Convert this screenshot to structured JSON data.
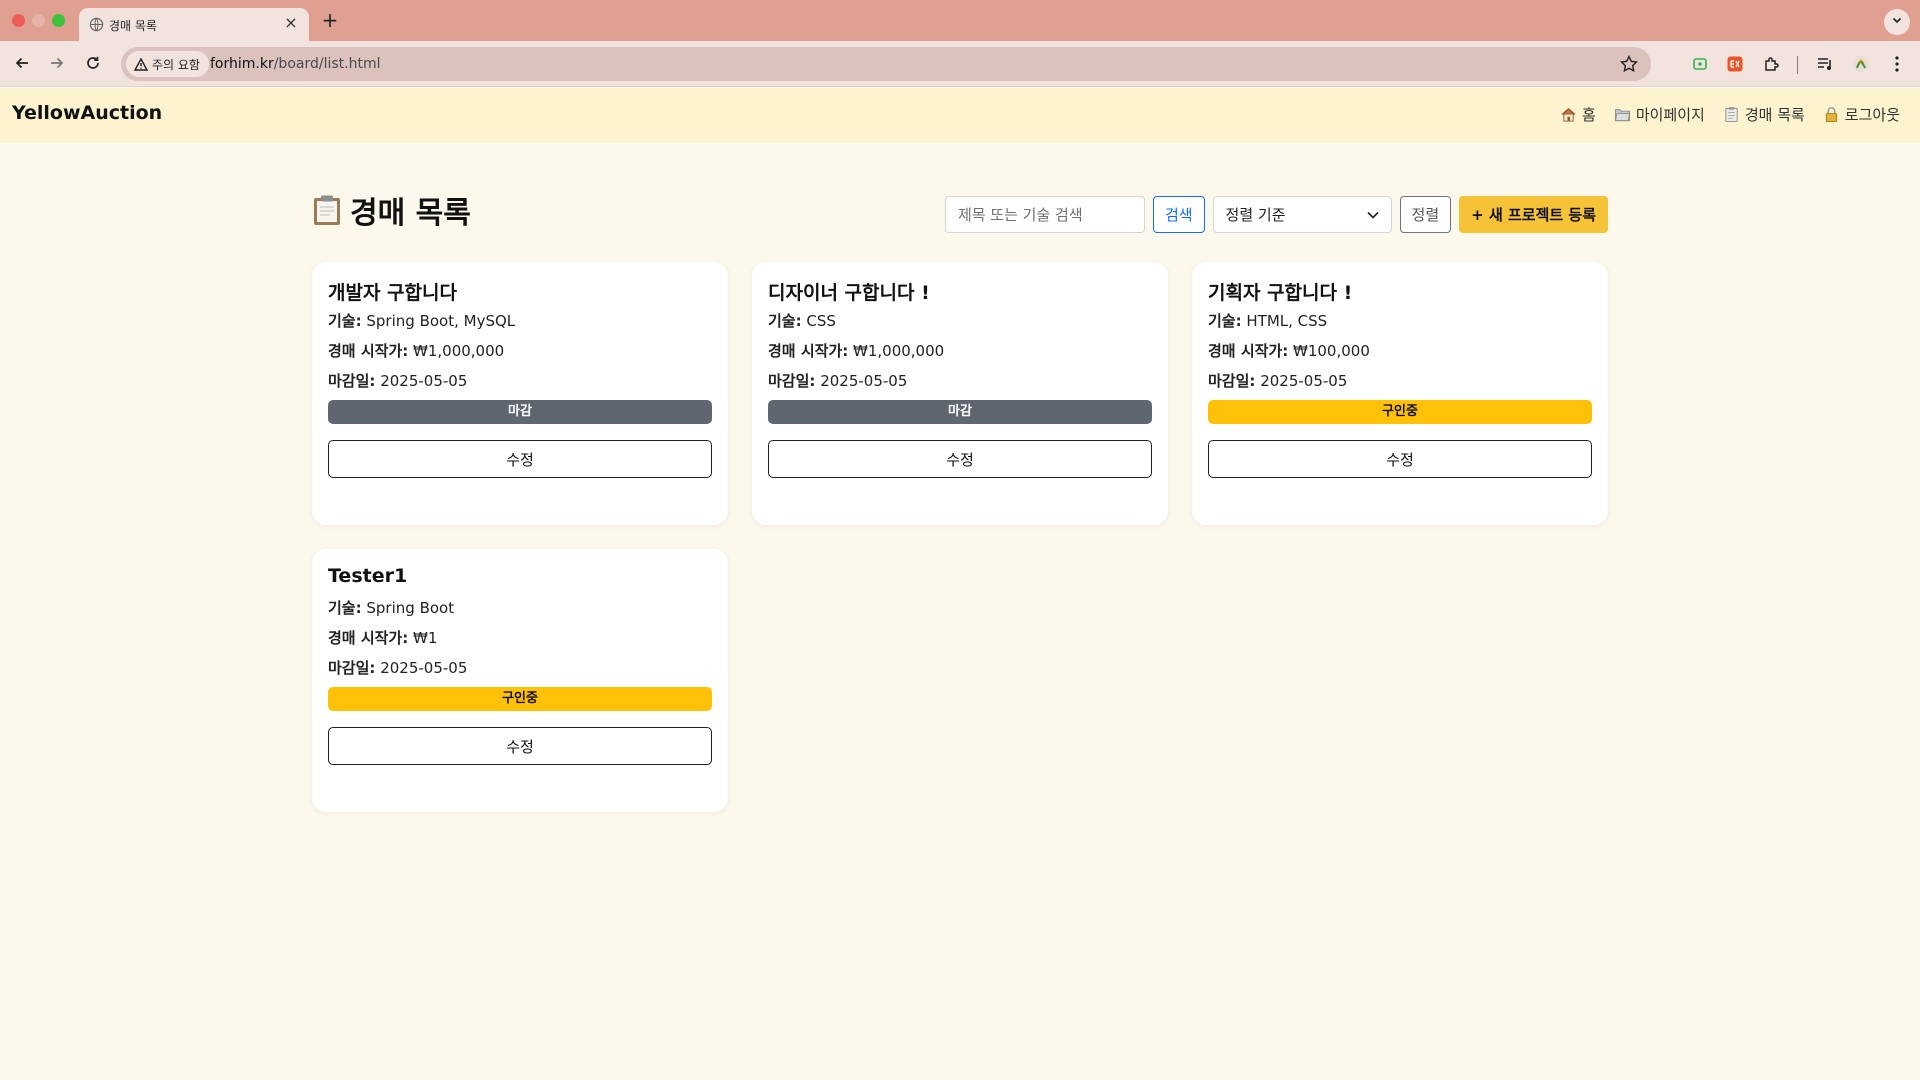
{
  "browser": {
    "tab_title": "경매 목록",
    "security_chip": "주의 요함",
    "url_host": "forhim.kr",
    "url_path": "/board/list.html"
  },
  "site": {
    "brand": "YellowAuction",
    "nav": [
      {
        "label": "홈",
        "icon": "house-icon"
      },
      {
        "label": "마이페이지",
        "icon": "folder-icon"
      },
      {
        "label": "경매 목록",
        "icon": "clipboard-icon"
      },
      {
        "label": "로그아웃",
        "icon": "lock-icon"
      }
    ]
  },
  "main": {
    "title": "경매 목록",
    "title_icon": "clipboard-icon",
    "search_placeholder": "제목 또는 기술 검색",
    "search_button": "검색",
    "sort_selected": "정렬 기준",
    "sort_button": "정렬",
    "new_button": "+ 새 프로젝트 등록"
  },
  "labels": {
    "skills": "기술:",
    "start_price": "경매 시작가:",
    "deadline": "마감일:",
    "edit": "수정"
  },
  "cards": [
    {
      "title": "개발자 구합니다",
      "skills": "Spring Boot, MySQL",
      "price": "₩1,000,000",
      "deadline": "2025-05-05",
      "status": "마감",
      "status_type": "closed"
    },
    {
      "title": "디자이너 구합니다 !",
      "skills": "CSS",
      "price": "₩1,000,000",
      "deadline": "2025-05-05",
      "status": "마감",
      "status_type": "closed"
    },
    {
      "title": "기획자 구합니다 !",
      "skills": "HTML, CSS",
      "price": "₩100,000",
      "deadline": "2025-05-05",
      "status": "구인중",
      "status_type": "open"
    },
    {
      "title": "Tester1",
      "skills": "Spring Boot",
      "price": "₩1",
      "deadline": "2025-05-05",
      "status": "구인중",
      "status_type": "open"
    }
  ],
  "colors": {
    "page_bg": "#fdf8ec",
    "header_bg": "#fdf3cf",
    "accent": "#f6c338",
    "badge_closed": "#5f6670",
    "badge_open": "#ffc107",
    "link_blue": "#0d6efd"
  }
}
